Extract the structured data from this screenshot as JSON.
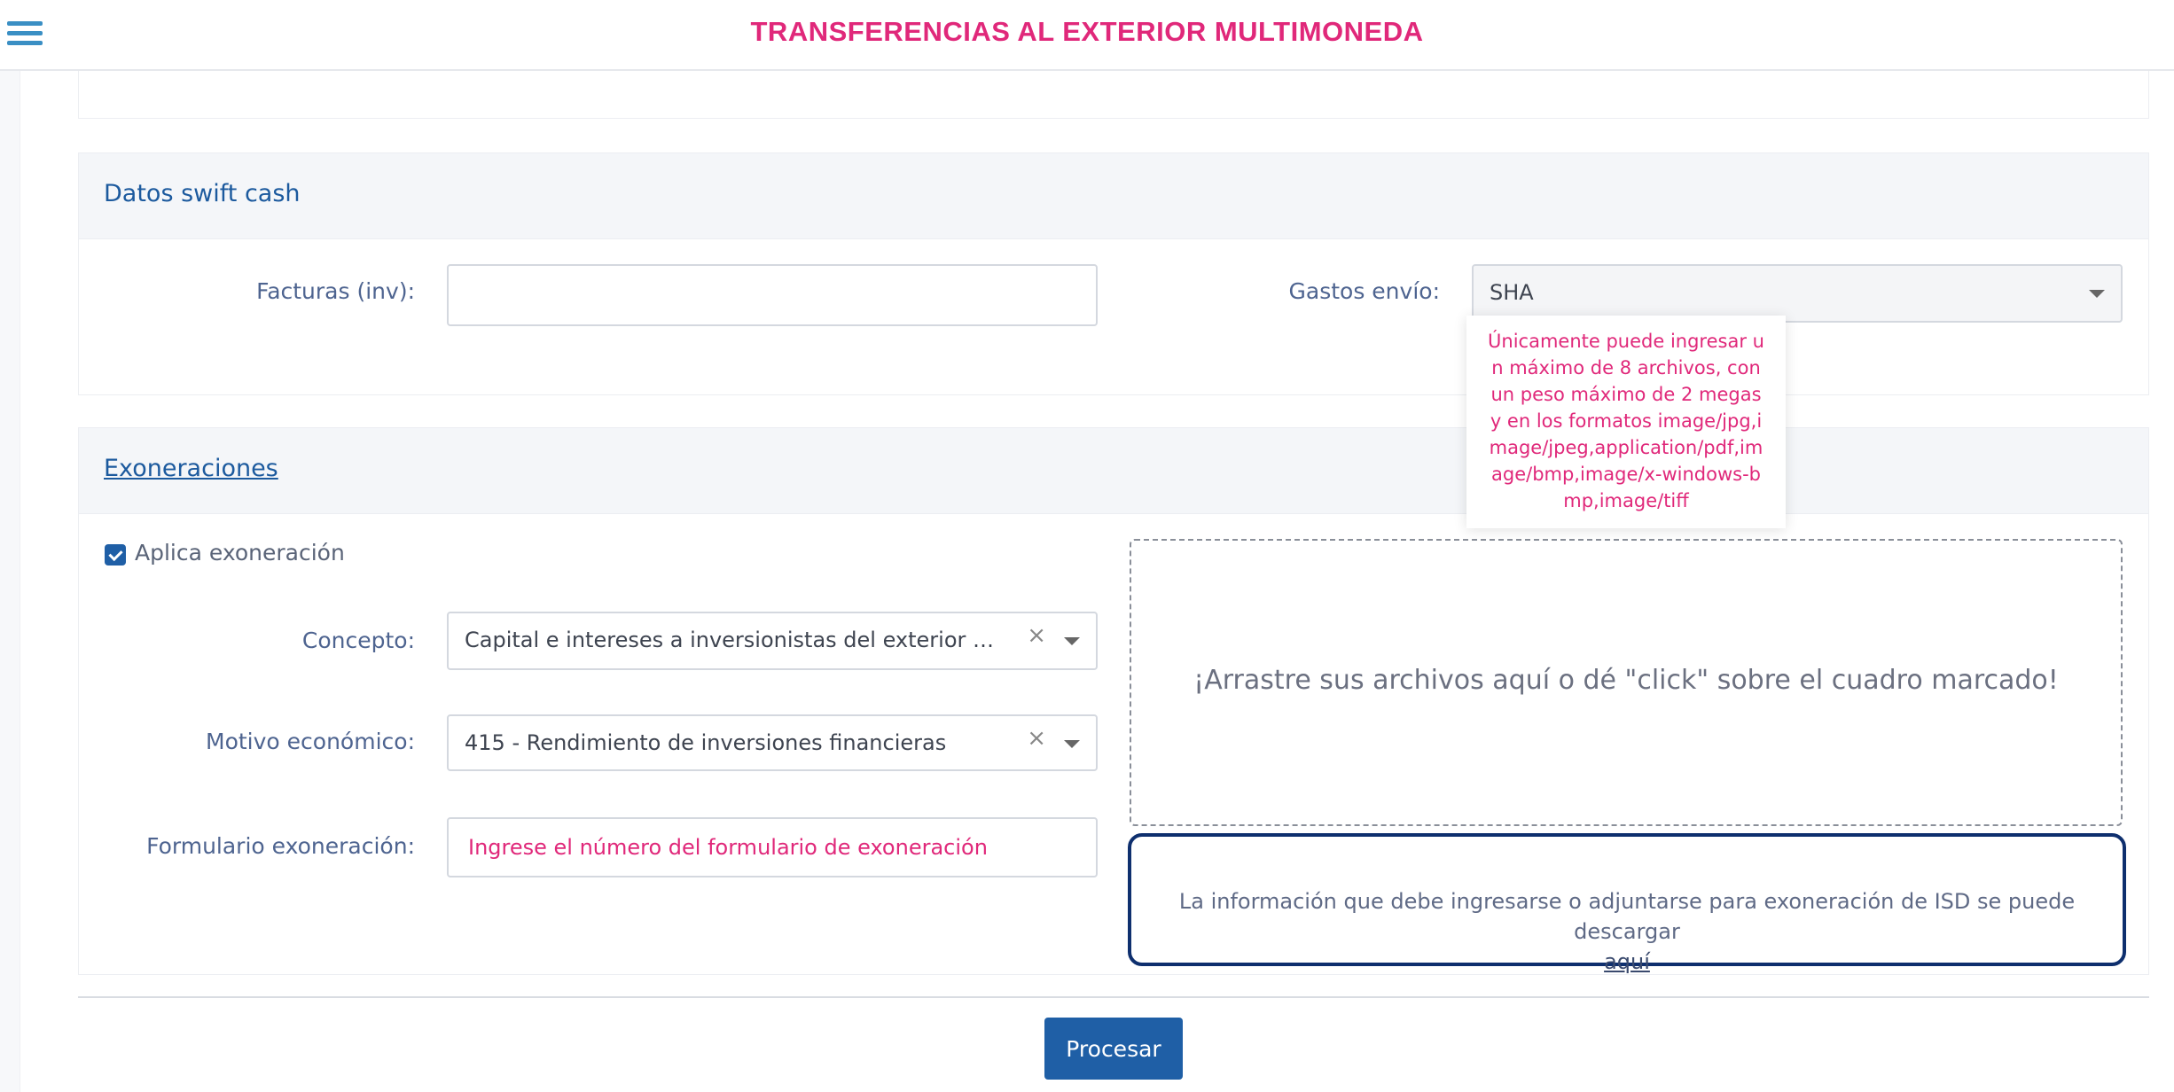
{
  "header": {
    "title": "TRANSFERENCIAS AL EXTERIOR MULTIMONEDA",
    "menu_icon": "hamburger-menu-icon"
  },
  "swift_section": {
    "title": "Datos swift cash",
    "invoices_label": "Facturas (inv):",
    "invoices_value": "",
    "shipping_label": "Gastos envío:",
    "shipping_value": "SHA"
  },
  "tooltip": {
    "text": "Únicamente puede ingresar un máximo de 8 archivos, con un peso máximo de 2 megas y en los formatos image/jpg,image/jpeg,application/pdf,image/bmp,image/x-windows-bmp,image/tiff"
  },
  "exoneration_section": {
    "title": "Exoneraciones",
    "checkbox_label": "Aplica exoneración",
    "checkbox_checked": true,
    "concept_label": "Concepto:",
    "concept_value": "Capital e intereses a inversionistas del exterior por de...",
    "motive_label": "Motivo económico:",
    "motive_value": "415 - Rendimiento de inversiones financieras",
    "form_label": "Formulario exoneración:",
    "form_placeholder": "Ingrese el número del formulario de exoneración",
    "clear_symbol": "×"
  },
  "dropzone": {
    "text": "¡Arrastre sus archivos aquí o dé \"click\" sobre el cuadro marcado!"
  },
  "info": {
    "text": "La información que debe ingresarse o adjuntarse para exoneración de ISD se puede descargar",
    "link": "aquí"
  },
  "actions": {
    "process_label": "Procesar"
  },
  "colors": {
    "accent": "#e0287a",
    "primary": "#1f5fa6",
    "title_blue": "#1c5a9e",
    "info_border": "#0e2f6e"
  }
}
